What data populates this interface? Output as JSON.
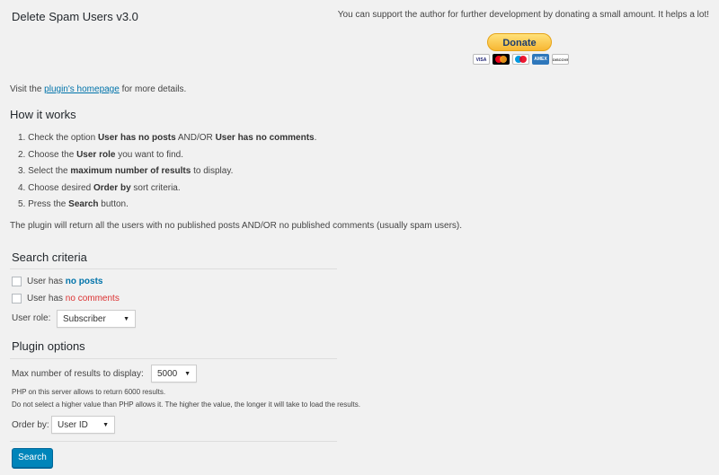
{
  "header": {
    "title": "Delete Spam Users v3.0",
    "support_text": "You can support the author for further development by donating a small amount. It helps a lot!",
    "donate_label": "Donate",
    "cards": [
      "VISA",
      "mastercard",
      "maestro",
      "AMEX",
      "DISCOVER"
    ]
  },
  "intro": {
    "visit_prefix": "Visit the",
    "homepage_link": "plugin's homepage",
    "visit_suffix": "for more details."
  },
  "how_it_works": {
    "title": "How it works",
    "steps": [
      {
        "n": "1.",
        "p1": "Check the option ",
        "b1": "User has no posts",
        "p2": " AND/OR ",
        "b2": "User has no comments",
        "p3": "."
      },
      {
        "n": "2.",
        "p1": "Choose the ",
        "b1": "User role",
        "p2": " you want to find.",
        "b2": "",
        "p3": ""
      },
      {
        "n": "3.",
        "p1": "Select the ",
        "b1": "maximum number of results",
        "p2": " to display.",
        "b2": "",
        "p3": ""
      },
      {
        "n": "4.",
        "p1": "Choose desired ",
        "b1": "Order by",
        "p2": " sort criteria.",
        "b2": "",
        "p3": ""
      },
      {
        "n": "5.",
        "p1": "Press the ",
        "b1": "Search",
        "p2": " button.",
        "b2": "",
        "p3": ""
      }
    ],
    "return_text": "The plugin will return all the users with no published posts AND/OR no published comments (usually spam users)."
  },
  "search_criteria": {
    "title": "Search criteria",
    "no_posts_prefix": "User has",
    "no_posts_highlight": "no posts",
    "no_comments_prefix": "User has",
    "no_comments_highlight": "no comments",
    "role_label": "User role:",
    "role_value": "Subscriber"
  },
  "plugin_options": {
    "title": "Plugin options",
    "max_label": "Max number of results to display:",
    "max_value": "5000",
    "php_note": "PHP on this server allows to return 6000 results.",
    "warning_note": "Do not select a higher value than PHP allows it. The higher the value, the longer it will take to load the results.",
    "order_label": "Order by:",
    "order_value": "User ID"
  },
  "search_button": "Search"
}
